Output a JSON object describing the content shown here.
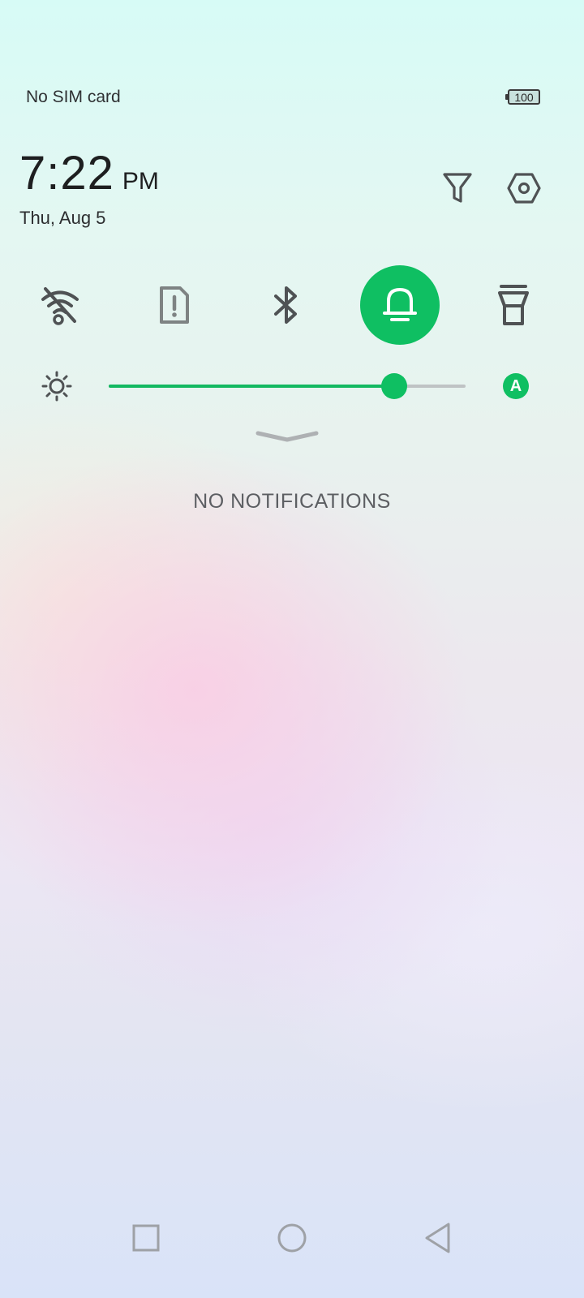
{
  "status_bar": {
    "carrier": "No SIM card",
    "battery_level": "100"
  },
  "header": {
    "time": "7:22",
    "ampm": "PM",
    "date": "Thu, Aug 5",
    "actions": [
      {
        "icon": "filter-icon"
      },
      {
        "icon": "settings-icon"
      }
    ]
  },
  "quick_settings": [
    {
      "icon": "wifi-off-icon",
      "active": false
    },
    {
      "icon": "sim-alert-icon",
      "active": false
    },
    {
      "icon": "bluetooth-icon",
      "active": false
    },
    {
      "icon": "bell-icon",
      "active": true
    },
    {
      "icon": "flashlight-icon",
      "active": false
    }
  ],
  "brightness": {
    "level_fraction": 0.8,
    "auto_label": "A"
  },
  "notifications": {
    "empty_text": "NO NOTIFICATIONS"
  },
  "nav_bar": [
    {
      "icon": "recents-square-icon"
    },
    {
      "icon": "home-circle-icon"
    },
    {
      "icon": "back-triangle-icon"
    }
  ],
  "colors": {
    "accent": "#0fbf62",
    "icon_gray": "#4f5254"
  }
}
